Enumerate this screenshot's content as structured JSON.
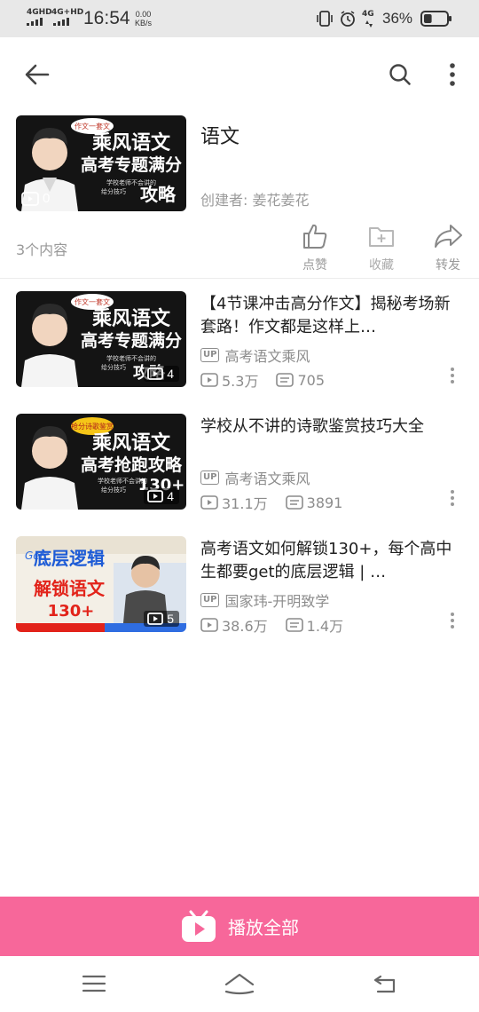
{
  "status_bar": {
    "network1": "4GHD",
    "network2": "4G+HD",
    "time": "16:54",
    "speed_value": "0.00",
    "speed_unit": "KB/s",
    "network3": "4G",
    "battery_percent": "36%",
    "battery_level": 0.36
  },
  "header": {
    "back_icon": "arrow-left-icon",
    "search_icon": "search-icon",
    "more_icon": "more-vertical-icon"
  },
  "playlist": {
    "title": "语文",
    "creator": "创建者: 姜花姜花",
    "cover_count": "0",
    "item_count": "3个内容",
    "actions": {
      "like_label": "点赞",
      "favorite_label": "收藏",
      "share_label": "转发"
    }
  },
  "videos": [
    {
      "title": "【4节课冲击高分作文】揭秘考场新套路！作文都是这样上…",
      "up_badge": "UP",
      "uploader": "高考语文乘风",
      "views": "5.3万",
      "danmaku": "705",
      "parts": "4"
    },
    {
      "title": "学校从不讲的诗歌鉴赏技巧大全",
      "up_badge": "UP",
      "uploader": "高考语文乘风",
      "views": "31.1万",
      "danmaku": "3891",
      "parts": "4"
    },
    {
      "title": "高考语文如何解锁130+，每个高中生都要get的底层逻辑 | …",
      "up_badge": "UP",
      "uploader": "国家玮-开明致学",
      "views": "38.6万",
      "danmaku": "1.4万",
      "parts": "5"
    }
  ],
  "thumbnails": {
    "t1_line1": "乘风语文",
    "t1_line2": "高考专题满分",
    "t1_line3": "攻略",
    "t1_small": "学校老师不会讲的",
    "t1_small2": "给分技巧",
    "t1_bubble": "作文一套文",
    "t2_line2": "高考抢跑攻略",
    "t2_line3": "130+",
    "t2_bubble": "抢分诗歌鉴赏",
    "t3_line1": "底层逻辑",
    "t3_line2": "解锁语文",
    "t3_line3": "130+",
    "t3_get": "Get"
  },
  "play_all": {
    "label": "播放全部",
    "color": "#f7679a"
  },
  "nav": {
    "menu_icon": "menu-icon",
    "home_icon": "home-icon",
    "back_icon": "back-nav-icon"
  }
}
